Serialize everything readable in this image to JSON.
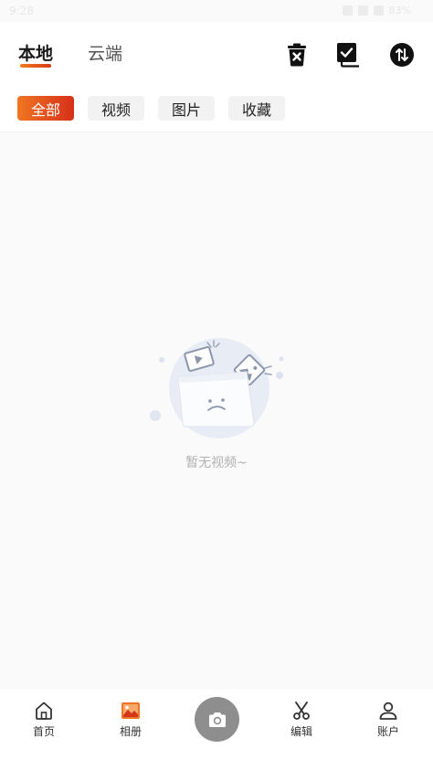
{
  "status_bar": {
    "time": "9:28",
    "battery": "83%"
  },
  "header": {
    "tabs": [
      {
        "label": "本地",
        "active": true
      },
      {
        "label": "云端",
        "active": false
      }
    ],
    "icons": [
      "delete-icon",
      "select-all-icon",
      "sort-icon"
    ]
  },
  "filters": [
    {
      "label": "全部",
      "active": true
    },
    {
      "label": "视频",
      "active": false
    },
    {
      "label": "图片",
      "active": false
    },
    {
      "label": "收藏",
      "active": false
    }
  ],
  "empty_state": {
    "message": "暂无视频~"
  },
  "bottom_nav": {
    "items": [
      {
        "label": "首页",
        "icon": "home-icon"
      },
      {
        "label": "相册",
        "icon": "album-icon",
        "active": true
      },
      {
        "label": "编辑",
        "icon": "scissors-icon"
      },
      {
        "label": "账户",
        "icon": "user-icon"
      }
    ],
    "camera_icon": "camera-icon"
  },
  "colors": {
    "accent_start": "#ef7622",
    "accent_end": "#d6301a",
    "chip_bg": "#f2f2f2",
    "empty_text": "#b0b0b0"
  }
}
